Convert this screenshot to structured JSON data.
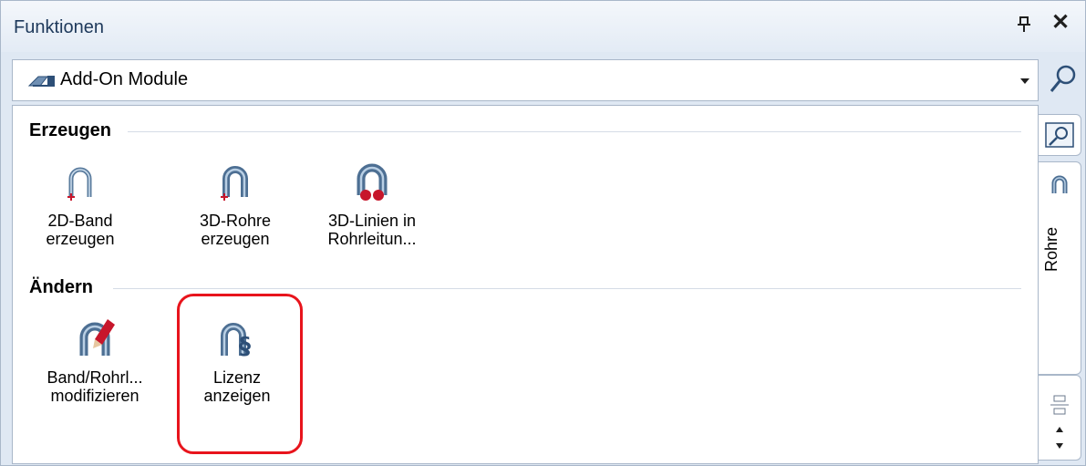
{
  "window": {
    "title": "Funktionen"
  },
  "selector": {
    "value": "Add-On Module"
  },
  "groups": [
    {
      "header": "Erzeugen",
      "tools": [
        {
          "line1": "2D-Band",
          "line2": "erzeugen"
        },
        {
          "line1": "3D-Rohre",
          "line2": "erzeugen"
        },
        {
          "line1": "3D-Linien in",
          "line2": "Rohrleitun..."
        }
      ]
    },
    {
      "header": "Ändern",
      "tools": [
        {
          "line1": "Band/Rohrl...",
          "line2": "modifizieren"
        },
        {
          "line1": "Lizenz",
          "line2": "anzeigen"
        }
      ]
    }
  ],
  "side_tabs": {
    "active_label": "Rohre"
  },
  "colors": {
    "highlight": "#e8141c",
    "accent": "#1e395b",
    "pipe": "#5b7c9e"
  }
}
